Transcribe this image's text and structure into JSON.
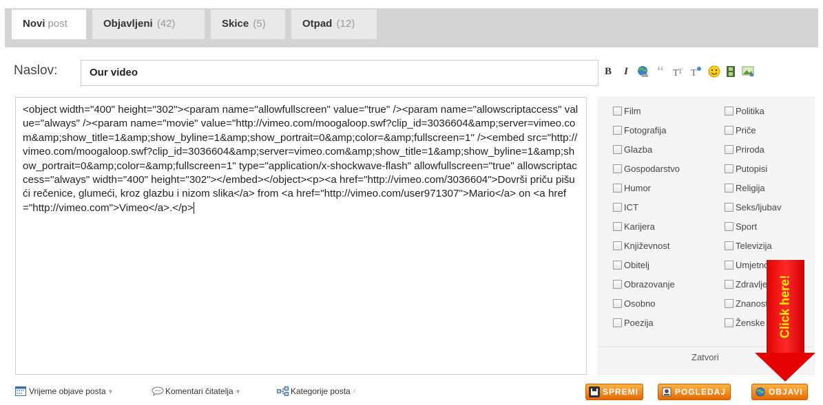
{
  "tabs": [
    {
      "name": "Novi",
      "suffix": "post",
      "active": true
    },
    {
      "name": "Objavljeni",
      "count": "(42)"
    },
    {
      "name": "Skice",
      "count": "(5)"
    },
    {
      "name": "Otpad",
      "count": "(12)"
    }
  ],
  "title_field": {
    "label": "Naslov:",
    "value": "Our video"
  },
  "toolbar": {
    "bold": "B",
    "italic": "I",
    "quote": "“"
  },
  "content": {
    "text": "<object width=\"400\" height=\"302\"><param name=\"allowfullscreen\" value=\"true\" /><param name=\"allowscriptaccess\" value=\"always\" /><param name=\"movie\" value=\"http://vimeo.com/moogaloop.swf?clip_id=3036604&amp;server=vimeo.com&amp;show_title=1&amp;show_byline=1&amp;show_portrait=0&amp;color=&amp;fullscreen=1\" /><embed src=\"http://vimeo.com/moogaloop.swf?clip_id=3036604&amp;server=vimeo.com&amp;show_title=1&amp;show_byline=1&amp;show_portrait=0&amp;color=&amp;fullscreen=1\" type=\"application/x-shockwave-flash\" allowfullscreen=\"true\" allowscriptaccess=\"always\" width=\"400\" height=\"302\"></embed></object><p><a href=\"http://vimeo.com/3036604\">Dovrši priču pišući rečenice, glumeći, kroz glazbu i nizom slika</a> from <a href=\"http://vimeo.com/user971307\">Mario</a> on <a href=\"http://vimeo.com\">Vimeo</a>.</p>"
  },
  "categories": {
    "left": [
      "Film",
      "Fotografija",
      "Glazba",
      "Gospodarstvo",
      "Humor",
      "ICT",
      "Karijera",
      "Književnost",
      "Obitelj",
      "Obrazovanje",
      "Osobno",
      "Poezija"
    ],
    "right": [
      "Politika",
      "Priče",
      "Priroda",
      "Putopisi",
      "Religija",
      "Seks/ljubav",
      "Sport",
      "Televizija",
      "Umjetnost",
      "Zdravlje",
      "Znanost",
      "Ženske teme"
    ],
    "close_label": "Zatvori"
  },
  "bottom": {
    "publish_time": "Vrijeme objave posta",
    "comments": "Komentari čitatelja",
    "categories": "Kategorije posta"
  },
  "buttons": {
    "save": "SPREMI",
    "preview": "POGLEDAJ",
    "publish": "OBJAVI"
  },
  "annotation": {
    "text": "Click here!"
  },
  "colors": {
    "button_orange": "#f08a1c",
    "arrow_red": "#e60000",
    "arrow_text": "#ffee00"
  }
}
